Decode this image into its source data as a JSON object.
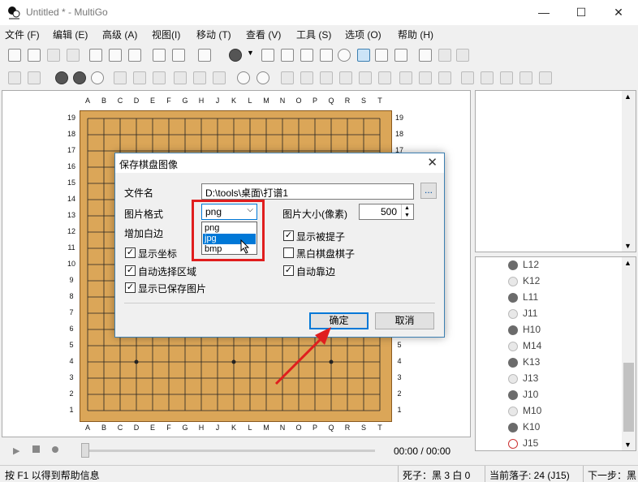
{
  "window": {
    "title": "Untitled  * - MultiGo",
    "controls": {
      "minimize": "—",
      "maximize": "☐",
      "close": "✕"
    }
  },
  "menu": [
    "文件 (F)",
    "编辑 (E)",
    "高级 (A)",
    "视图(I)",
    "移动 (T)",
    "查看 (V)",
    "工具 (S)",
    "选项 (O)",
    "帮助 (H)"
  ],
  "board": {
    "columns": [
      "A",
      "B",
      "C",
      "D",
      "E",
      "F",
      "G",
      "H",
      "J",
      "K",
      "L",
      "M",
      "N",
      "O",
      "P",
      "Q",
      "R",
      "S",
      "T"
    ],
    "rows": [
      "19",
      "18",
      "17",
      "16",
      "15",
      "14",
      "13",
      "12",
      "11",
      "10",
      "9",
      "8",
      "7",
      "6",
      "5",
      "4",
      "3",
      "2",
      "1"
    ]
  },
  "dialog": {
    "title": "保存棋盘图像",
    "close": "✕",
    "filename_label": "文件名",
    "filename_value": "D:\\tools\\桌面\\打谱1",
    "browse_label": "...",
    "format_label": "图片格式",
    "format_value": "png",
    "format_options": [
      "png",
      "jpg",
      "bmp"
    ],
    "format_selected_index": 1,
    "size_label": "图片大小(像素)",
    "size_value": "500",
    "margin_label": "增加白边",
    "options_left": [
      {
        "label": "显示坐标",
        "checked": true
      },
      {
        "label": "自动选择区域",
        "checked": true
      },
      {
        "label": "显示已保存图片",
        "checked": true
      }
    ],
    "options_right": [
      {
        "label": "显示被提子",
        "checked": true
      },
      {
        "label": "黑白棋盘棋子",
        "checked": false
      },
      {
        "label": "自动靠边",
        "checked": true
      }
    ],
    "ok_label": "确定",
    "cancel_label": "取消"
  },
  "moves": [
    {
      "label": "L12",
      "color": "black"
    },
    {
      "label": "K12",
      "color": "white"
    },
    {
      "label": "L11",
      "color": "black"
    },
    {
      "label": "J11",
      "color": "white"
    },
    {
      "label": "H10",
      "color": "black"
    },
    {
      "label": "M14",
      "color": "white"
    },
    {
      "label": "K13",
      "color": "black"
    },
    {
      "label": "J13",
      "color": "white"
    },
    {
      "label": "J10",
      "color": "black"
    },
    {
      "label": "M10",
      "color": "white"
    },
    {
      "label": "K10",
      "color": "black"
    },
    {
      "label": "J15",
      "color": "current"
    }
  ],
  "player": {
    "time": "00:00 / 00:00"
  },
  "status": {
    "help": "按 F1 以得到帮助信息",
    "captures": "死子：黑 3 白 0",
    "current_move": "当前落子: 24 (J15)",
    "next": "下一步：黑"
  },
  "colors": {
    "board": "#dba658",
    "accent": "#0078d7",
    "highlight": "#e01e1e"
  }
}
